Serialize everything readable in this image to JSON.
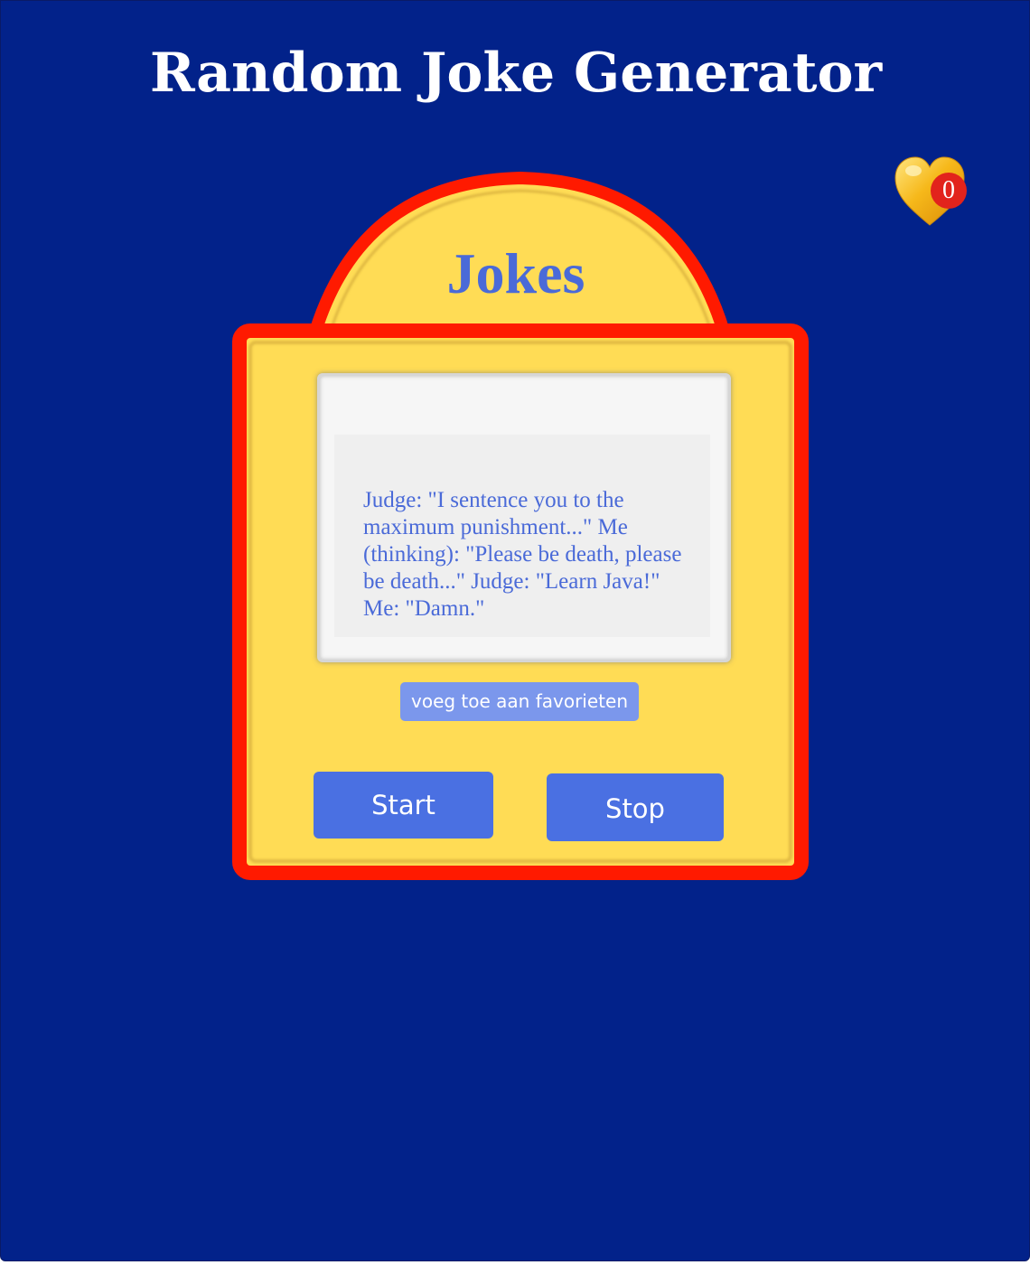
{
  "header": {
    "title": "Random Joke Generator"
  },
  "favorites": {
    "icon": "heart-icon",
    "count": "0",
    "heart_color": "#f6b81a",
    "badge_color": "#e2231c"
  },
  "machine": {
    "title": "Jokes",
    "joke": "Judge: \"I sentence you to the maximum punishment...\" Me (thinking): \"Please be death, please be death...\" Judge: \"Learn Java!\" Me: \"Damn.\"",
    "add_favorite_label": "voeg toe aan favorieten",
    "start_label": "Start",
    "stop_label": "Stop",
    "frame_color": "#ff1a00",
    "panel_color": "#ffdc55"
  },
  "theme": {
    "background": "#02228a",
    "text_accent": "#4a6ad8",
    "button_color": "#4a70e2"
  }
}
